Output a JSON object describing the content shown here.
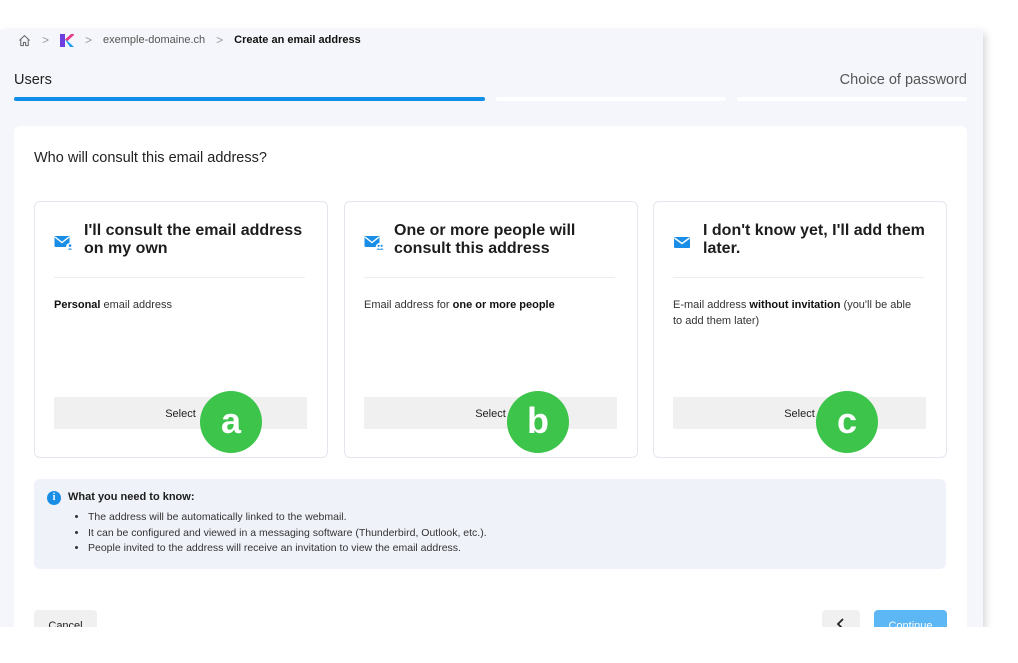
{
  "breadcrumb": {
    "items": [
      "exemple-domaine.ch",
      "Create an email address"
    ],
    "separator": ">"
  },
  "stepper": {
    "step1_label": "Users",
    "step2_label": "Choice of password",
    "progress": [
      1,
      0,
      0
    ],
    "accent_color": "#0e8ee6"
  },
  "question": "Who will consult this email address?",
  "cards": [
    {
      "title": "I'll consult the email address on my own",
      "desc_bold": "Personal",
      "desc_rest": " email address",
      "button": "Select",
      "badge": "a",
      "icon": "mail-user-icon"
    },
    {
      "title": "One or more people will consult this address",
      "desc_pre": "Email address for ",
      "desc_bold": "one or more people",
      "button": "Select",
      "badge": "b",
      "icon": "mail-group-icon"
    },
    {
      "title": "I don't know yet, I'll add them later.",
      "desc_pre": "E-mail address ",
      "desc_bold": "without invitation",
      "desc_rest": " (you'll be able to add them later)",
      "button": "Select",
      "badge": "c",
      "icon": "mail-icon"
    }
  ],
  "info": {
    "icon": "info-icon",
    "icon_glyph": "i",
    "title": "What you need to know:",
    "bullets": [
      "The address will be automatically linked to the webmail.",
      "It can be configured and viewed in a messaging software (Thunderbird, Outlook, etc.).",
      "People invited to the address will receive an invitation to view the email address."
    ]
  },
  "footer": {
    "cancel": "Cancel",
    "back_icon": "chevron-left-icon",
    "continue": "Continue",
    "continue_color": "#5db7f5"
  },
  "badge_color": "#3cc54a"
}
